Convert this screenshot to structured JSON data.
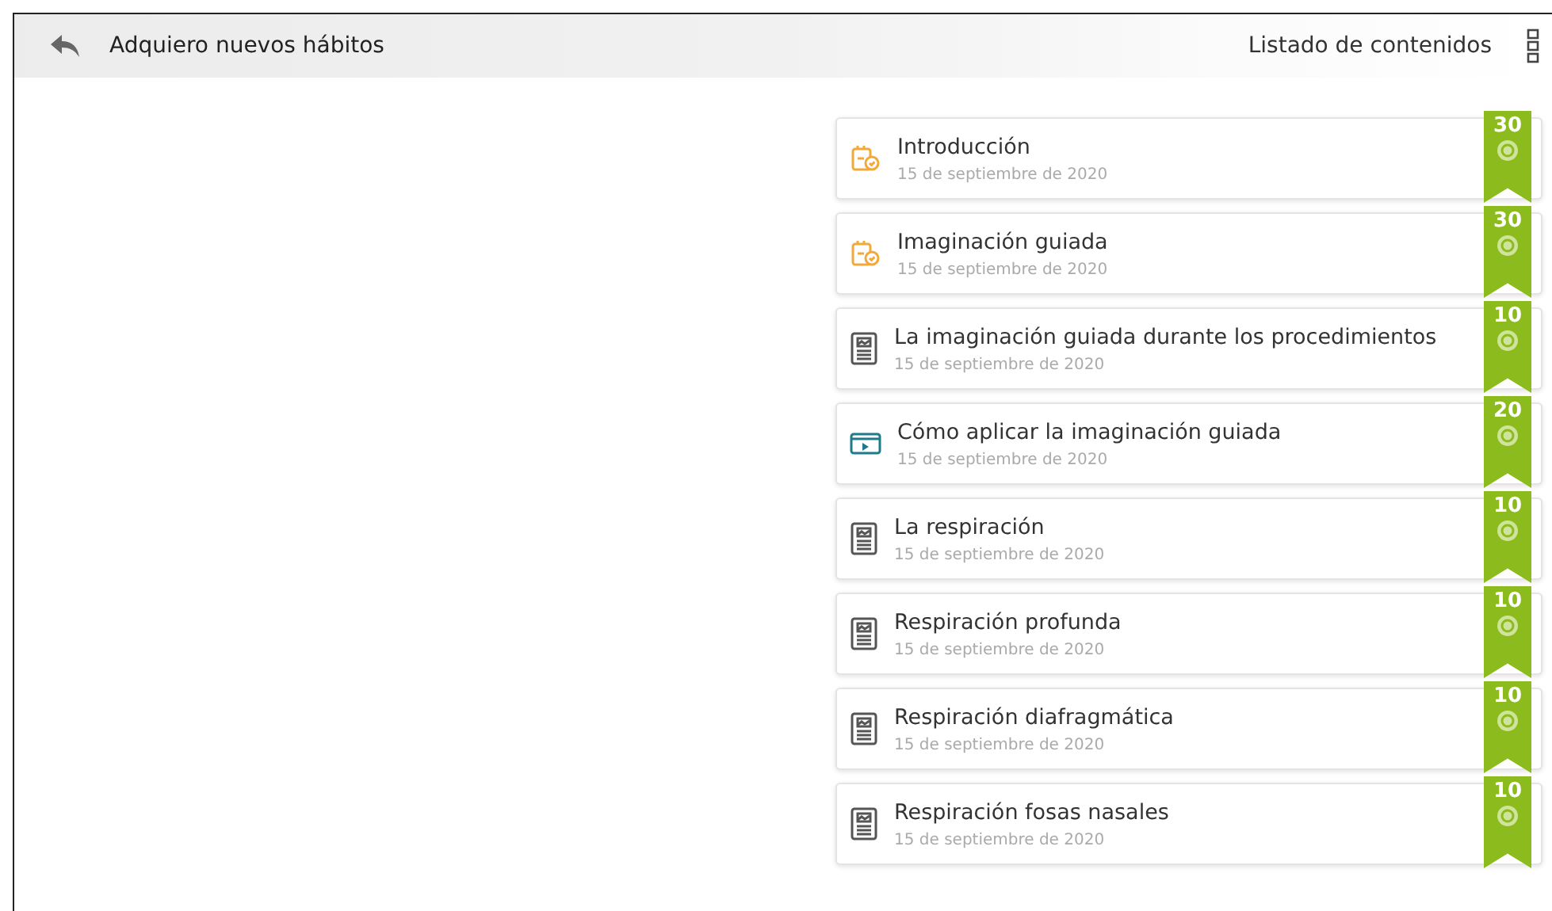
{
  "header": {
    "title": "Adquiero nuevos hábitos",
    "contents_link": "Listado de contenidos"
  },
  "items": [
    {
      "kind": "task",
      "title": "Introducción",
      "date": "15 de septiembre de 2020",
      "points": "30"
    },
    {
      "kind": "task",
      "title": "Imaginación guiada",
      "date": "15 de septiembre de 2020",
      "points": "30"
    },
    {
      "kind": "document",
      "title": "La imaginación guiada durante los procedimientos",
      "date": "15 de septiembre de 2020",
      "points": "10"
    },
    {
      "kind": "video",
      "title": "Cómo aplicar la imaginación guiada",
      "date": "15 de septiembre de 2020",
      "points": "20"
    },
    {
      "kind": "document",
      "title": "La respiración",
      "date": "15 de septiembre de 2020",
      "points": "10"
    },
    {
      "kind": "document",
      "title": "Respiración profunda",
      "date": "15 de septiembre de 2020",
      "points": "10"
    },
    {
      "kind": "document",
      "title": "Respiración diafragmática",
      "date": "15 de septiembre de 2020",
      "points": "10"
    },
    {
      "kind": "document",
      "title": "Respiración fosas nasales",
      "date": "15 de septiembre de 2020",
      "points": "10"
    }
  ]
}
